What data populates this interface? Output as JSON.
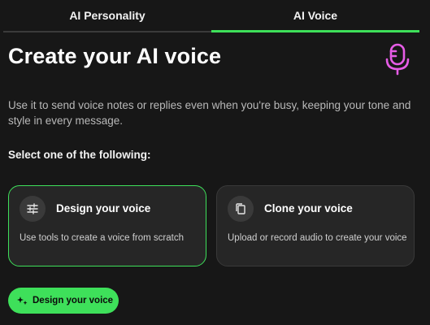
{
  "tabs": [
    {
      "label": "AI Personality",
      "active": false
    },
    {
      "label": "AI Voice",
      "active": true
    }
  ],
  "header": {
    "title": "Create your AI voice",
    "icon": "microphone-icon",
    "icon_color": "#e65ce6"
  },
  "description": "Use it to send voice notes or replies even when you're busy, keeping your tone and style in every message.",
  "select_label": "Select one of the following:",
  "options": [
    {
      "icon": "sliders-icon",
      "title": "Design your voice",
      "description": "Use tools to create a voice from scratch",
      "selected": true
    },
    {
      "icon": "copy-icon",
      "title": "Clone your voice",
      "description": "Upload or record audio to create your voice",
      "selected": false
    }
  ],
  "primary_button": {
    "label": "Design your voice",
    "icon": "sparkle-icon"
  },
  "colors": {
    "accent": "#3ee05a",
    "background": "#171717",
    "card": "#262626",
    "mic": "#e65ce6"
  }
}
